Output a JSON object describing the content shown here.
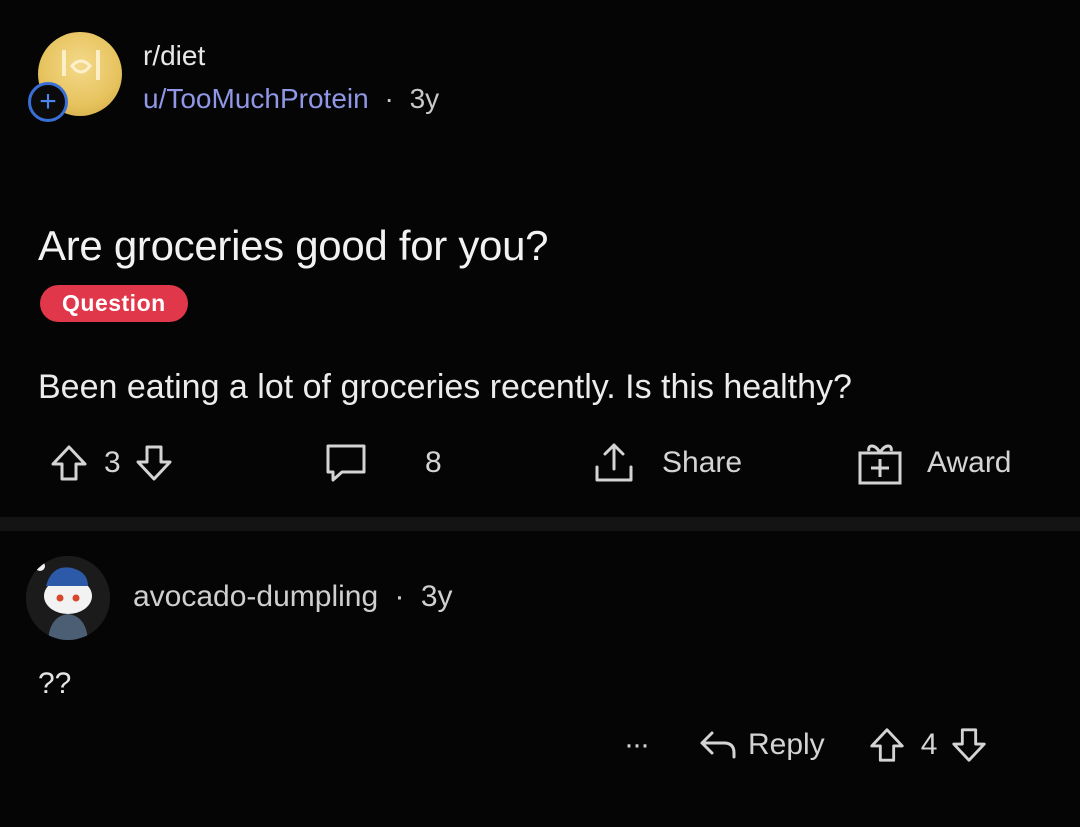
{
  "post": {
    "subreddit": "r/diet",
    "author": "u/TooMuchProtein",
    "separator": "·",
    "age": "3y",
    "title": "Are groceries good for you?",
    "flair": "Question",
    "body": "Been eating a lot of groceries recently. Is this healthy?",
    "vote_count": "3",
    "comment_count": "8",
    "share_label": "Share",
    "award_label": "Award"
  },
  "comment": {
    "author": "avocado-dumpling",
    "separator": "·",
    "age": "3y",
    "body": "??",
    "more_label": "···",
    "reply_label": "Reply",
    "vote_count": "4"
  },
  "colors": {
    "background": "#050505",
    "username": "#8f97e6",
    "flair": "#e0384a",
    "join_badge": "#3a6fd8",
    "subreddit_icon": "#e7c35e"
  },
  "icons": [
    "plus-icon",
    "upvote-icon",
    "downvote-icon",
    "comment-icon",
    "share-icon",
    "award-icon",
    "reply-icon",
    "more-icon"
  ]
}
